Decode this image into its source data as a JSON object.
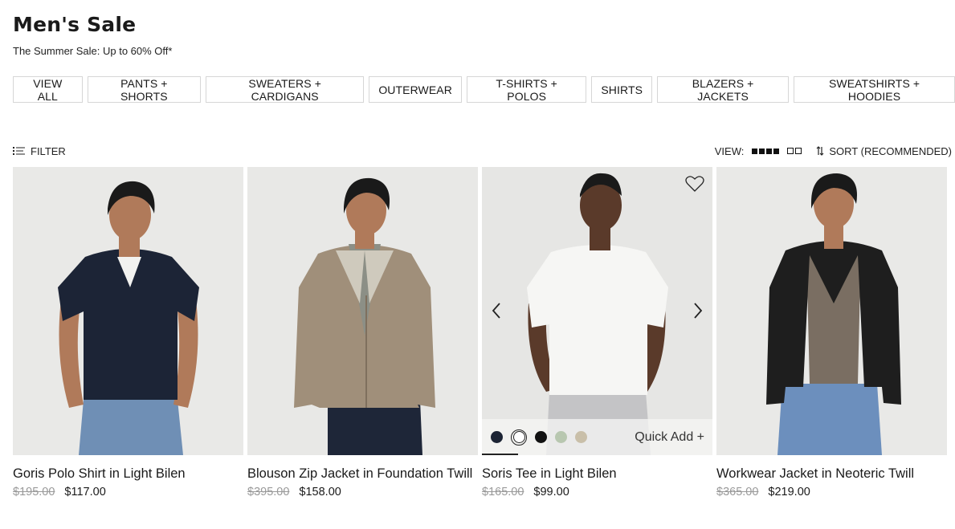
{
  "header": {
    "title": "Men's Sale",
    "subtitle": "The Summer Sale: Up to 60% Off*"
  },
  "categories": [
    {
      "label": "VIEW ALL"
    },
    {
      "label": "PANTS + SHORTS"
    },
    {
      "label": "SWEATERS + CARDIGANS"
    },
    {
      "label": "OUTERWEAR"
    },
    {
      "label": "T-SHIRTS + POLOS"
    },
    {
      "label": "SHIRTS"
    },
    {
      "label": "BLAZERS + JACKETS"
    },
    {
      "label": "SWEATSHIRTS + HOODIES"
    }
  ],
  "toolbar": {
    "filter_label": "FILTER",
    "filter_icon": "filter-list-icon",
    "view_label": "VIEW:",
    "view_dense_icon": "grid-4-icon",
    "view_loose_icon": "grid-2-icon",
    "sort_label": "SORT (RECOMMENDED)",
    "sort_icon": "sort-arrows-icon"
  },
  "products": [
    {
      "name": "Goris Polo Shirt in Light Bilen",
      "price_original": "$195.00",
      "price_sale": "$117.00",
      "image_desc": "navy-polo-model"
    },
    {
      "name": "Blouson Zip Jacket in Foundation Twill",
      "price_original": "$395.00",
      "price_sale": "$158.00",
      "image_desc": "khaki-blouson-model"
    },
    {
      "name": "Soris Tee in Light Bilen",
      "price_original": "$165.00",
      "price_sale": "$99.00",
      "image_desc": "white-tee-model",
      "hover": {
        "quick_add_label": "Quick Add +",
        "swatches": [
          "#1c2434",
          "#ffffff",
          "#111111",
          "#b8c7b0",
          "#c9bfa9"
        ],
        "selected_swatch_index": 1
      }
    },
    {
      "name": "Workwear Jacket in Neoteric Twill",
      "price_original": "$365.00",
      "price_sale": "$219.00",
      "image_desc": "black-workwear-jacket-model"
    }
  ],
  "colors": {
    "background": "#ffffff",
    "text": "#1a1a1a",
    "strike_price": "#9a9a9a",
    "border": "#d6d6d6",
    "image_bg": "#e7e7e5"
  }
}
